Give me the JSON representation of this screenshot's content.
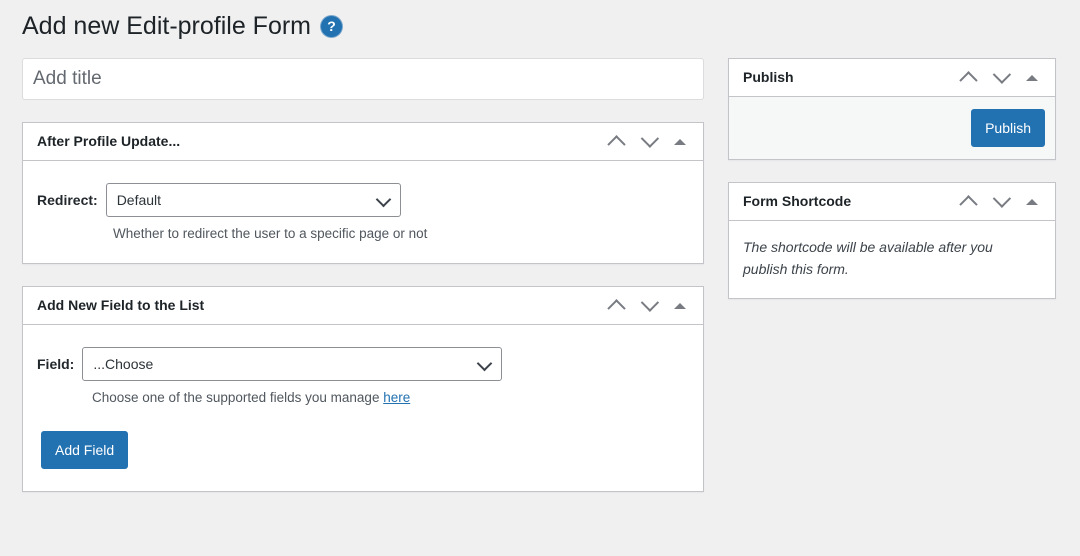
{
  "header": {
    "title": "Add new Edit-profile Form",
    "help_icon": "help-circle-icon",
    "help_label": "?"
  },
  "title_field": {
    "placeholder": "Add title",
    "value": ""
  },
  "panels": [
    {
      "id": "after-profile-update",
      "title": "After Profile Update...",
      "field_label": "Redirect:",
      "select_value": "Default",
      "select_options": [
        "Default"
      ],
      "description": "Whether to redirect the user to a specific page or not"
    },
    {
      "id": "add-new-field",
      "title": "Add New Field to the List",
      "field_label": "Field:",
      "select_value": "...Choose",
      "select_options": [
        "...Choose"
      ],
      "description_prefix": "Choose one of the supported fields you manage ",
      "description_link": "here",
      "button_label": "Add Field"
    }
  ],
  "handle_actions": {
    "move_up_icon": "chevron-up-icon",
    "move_down_icon": "chevron-down-icon",
    "toggle_icon": "triangle-up-icon"
  },
  "sidebar": {
    "publish": {
      "title": "Publish",
      "button_label": "Publish"
    },
    "shortcode": {
      "title": "Form Shortcode",
      "message": "The shortcode will be available after you publish this form."
    }
  },
  "colors": {
    "accent": "#2271b1",
    "page_background": "#f0f0f1",
    "panel_border": "#c3c4c7",
    "heading_text": "#1d2327"
  }
}
